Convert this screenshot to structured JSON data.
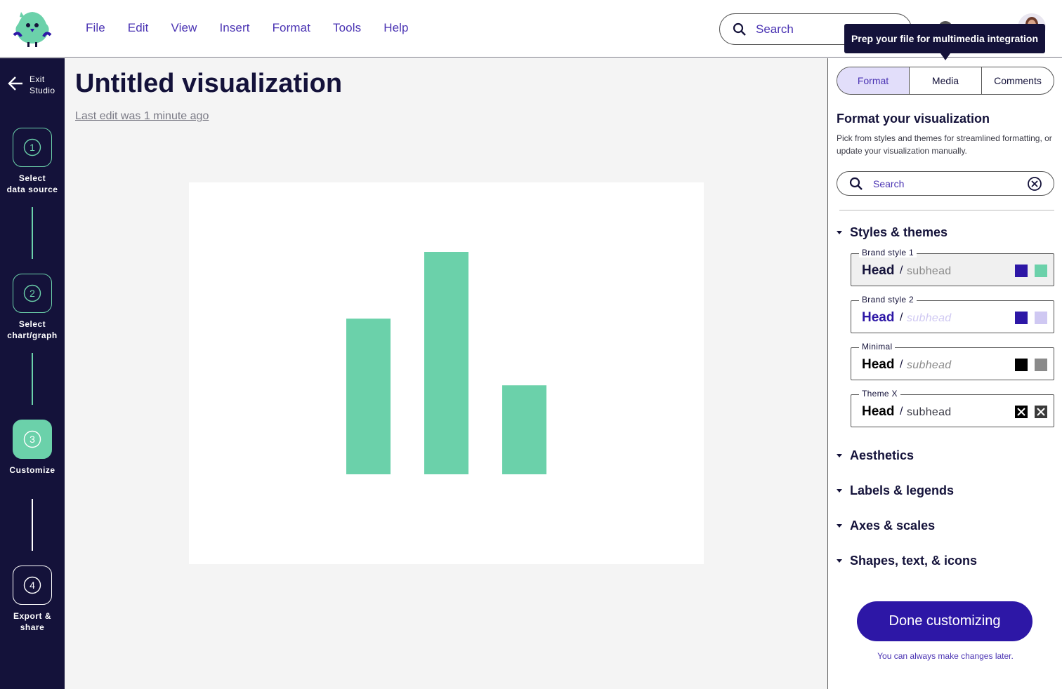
{
  "app": {
    "menu": [
      "File",
      "Edit",
      "View",
      "Insert",
      "Format",
      "Tools",
      "Help"
    ],
    "search_placeholder": "Search",
    "tooltip": "Prep your file for multimedia integration"
  },
  "rail": {
    "exit_label_line1": "Exit",
    "exit_label_line2": "Studio",
    "steps": [
      {
        "number": "1",
        "line1": "Select",
        "line2": "data source"
      },
      {
        "number": "2",
        "line1": "Select",
        "line2": "chart/graph"
      },
      {
        "number": "3",
        "line1": "Customize",
        "line2": ""
      },
      {
        "number": "4",
        "line1": "Export &",
        "line2": "share"
      }
    ]
  },
  "main": {
    "title": "Untitled visualization",
    "last_edit": "Last edit was 1 minute ago"
  },
  "chart_data": {
    "type": "bar",
    "categories": [
      "",
      "",
      ""
    ],
    "values": [
      70,
      100,
      40
    ],
    "ylim": [
      0,
      100
    ],
    "color": "#6bd1aa",
    "title": "",
    "xlabel": "",
    "ylabel": ""
  },
  "panel": {
    "tabs": [
      "Format",
      "Media",
      "Comments"
    ],
    "active_tab": "Format",
    "title": "Format your visualization",
    "description": "Pick from styles and themes for streamlined formatting, or update your visualization manually.",
    "search_placeholder": "Search",
    "sections": {
      "styles": "Styles & themes",
      "aesthetics": "Aesthetics",
      "labels": "Labels & legends",
      "axes": "Axes & scales",
      "shapes": "Shapes, text, & icons"
    },
    "styles": [
      {
        "label": "Brand style 1",
        "head": "Head",
        "slash": "/",
        "sub": "subhead",
        "colors": [
          "#2d17a6",
          "#6bd1aa"
        ]
      },
      {
        "label": "Brand style 2",
        "head": "Head",
        "slash": "/",
        "sub": "subhead",
        "colors": [
          "#2d17a6",
          "#cfc8f2"
        ]
      },
      {
        "label": "Minimal",
        "head": "Head",
        "slash": "/",
        "sub": "subhead",
        "colors": [
          "#000000",
          "#8a8a8a"
        ]
      },
      {
        "label": "Theme X",
        "head": "Head",
        "slash": "/",
        "sub": "subhead",
        "colors": [
          "#000000",
          "#3a3a3a"
        ]
      }
    ],
    "done_label": "Done customizing",
    "done_note": "You can always make changes later."
  }
}
